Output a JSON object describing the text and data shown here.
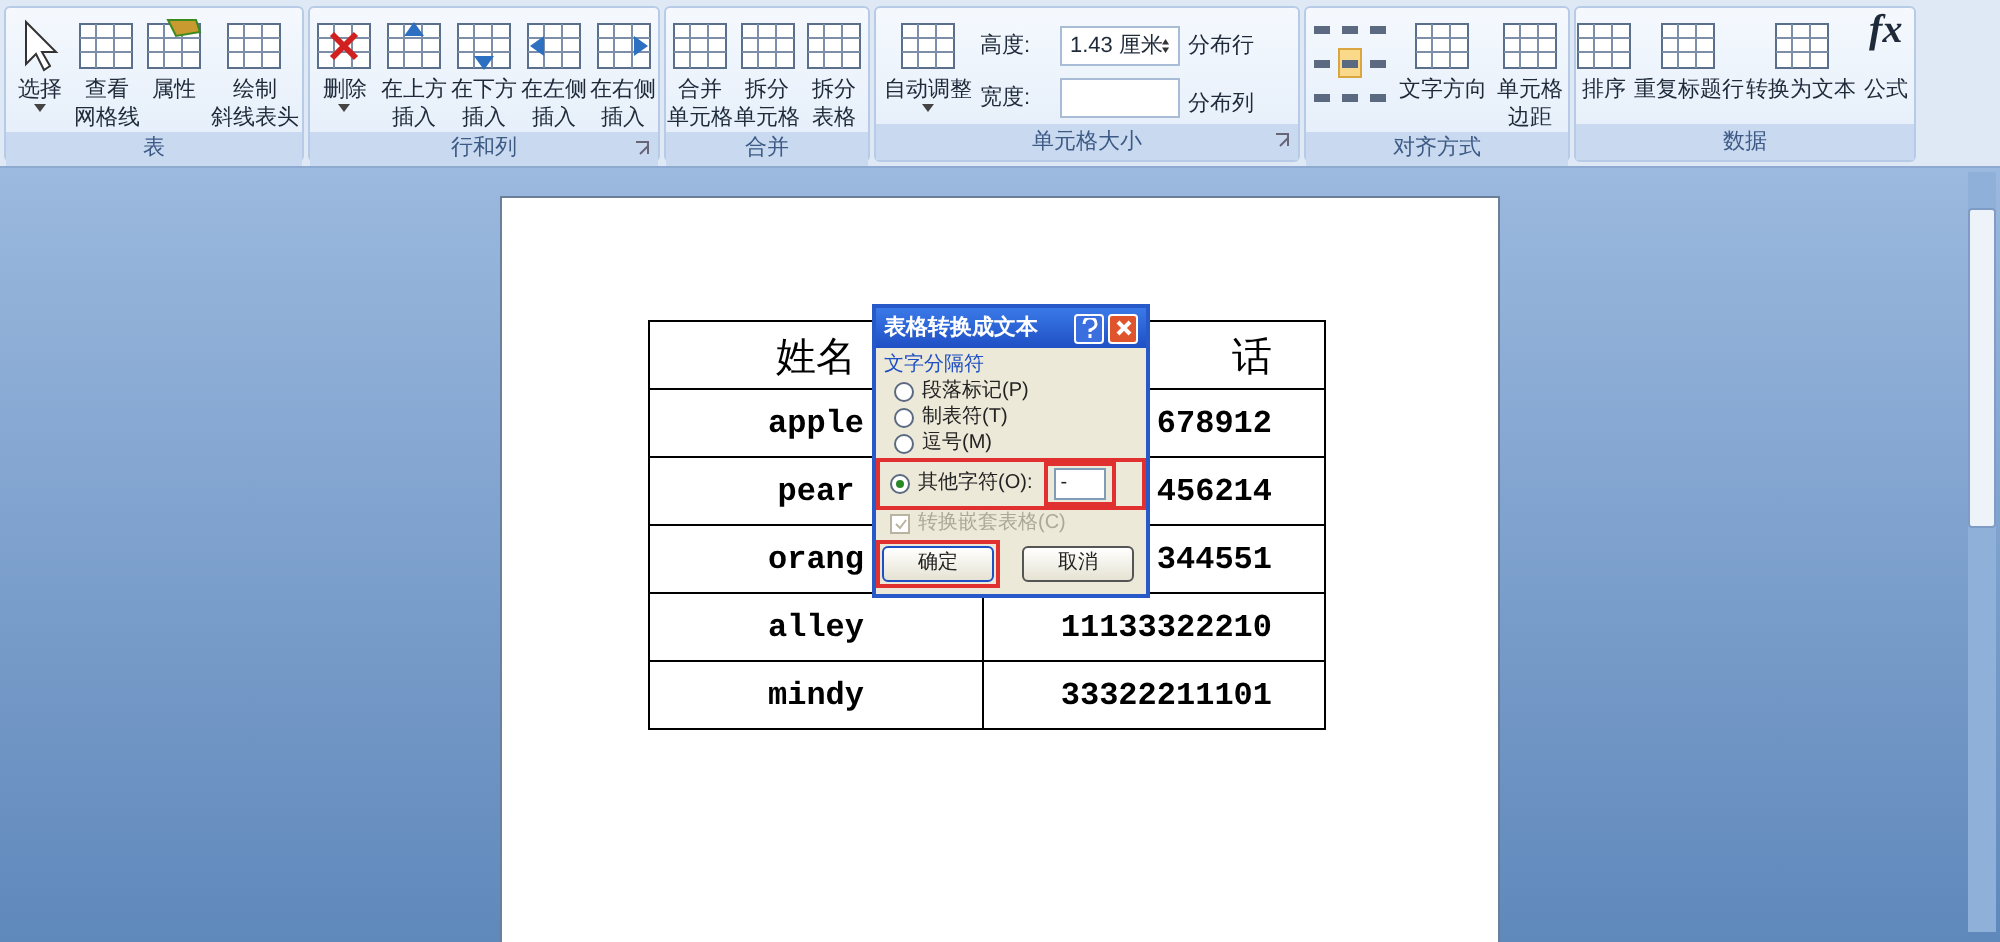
{
  "ribbon": {
    "groups": [
      {
        "label": "表",
        "launcher": false,
        "items": [
          {
            "lines": [
              "选择"
            ],
            "dropdown": true
          },
          {
            "lines": [
              "查看",
              "网格线"
            ],
            "dropdown": false
          },
          {
            "lines": [
              "属性"
            ],
            "dropdown": false
          },
          {
            "lines": [
              "绘制",
              "斜线表头"
            ],
            "dropdown": false
          }
        ]
      },
      {
        "label": "行和列",
        "launcher": true,
        "items": [
          {
            "lines": [
              "删除"
            ],
            "dropdown": true
          },
          {
            "lines": [
              "在上方",
              "插入"
            ],
            "dropdown": false
          },
          {
            "lines": [
              "在下方",
              "插入"
            ],
            "dropdown": false
          },
          {
            "lines": [
              "在左侧",
              "插入"
            ],
            "dropdown": false
          },
          {
            "lines": [
              "在右侧",
              "插入"
            ],
            "dropdown": false
          }
        ]
      },
      {
        "label": "合并",
        "launcher": false,
        "items": [
          {
            "lines": [
              "合并",
              "单元格"
            ],
            "dropdown": false
          },
          {
            "lines": [
              "拆分",
              "单元格"
            ],
            "dropdown": false
          },
          {
            "lines": [
              "拆分",
              "表格"
            ],
            "dropdown": false
          }
        ]
      }
    ],
    "cell_size": {
      "label": "单元格大小",
      "autofit": {
        "lines": [
          "自动调整"
        ],
        "dropdown": true
      },
      "height_label": "高度:",
      "height_value": "1.43 厘米",
      "width_label": "宽度:",
      "distribute_rows": "分布行",
      "distribute_columns": "分布列"
    },
    "alignment": {
      "label": "对齐方式",
      "cells": [
        {
          "selected": false
        },
        {
          "selected": false
        },
        {
          "selected": false
        },
        {
          "selected": false
        },
        {
          "selected": true
        },
        {
          "selected": false
        },
        {
          "selected": false
        },
        {
          "selected": false
        },
        {
          "selected": false
        }
      ],
      "text_direction": "文字方向",
      "margins": [
        "单元格",
        "边距"
      ]
    },
    "data": {
      "label": "数据",
      "formula_glyph": "fx",
      "items": [
        {
          "lines": [
            "排序"
          ]
        },
        {
          "lines": [
            "重复标题行"
          ]
        },
        {
          "lines": [
            "转换为文本"
          ]
        },
        {
          "lines": [
            "公式"
          ]
        }
      ]
    }
  },
  "table": {
    "rows": [
      {
        "name": "姓名",
        "phone": "话",
        "header": true
      },
      {
        "name": "apple",
        "phone": "678912",
        "header": false
      },
      {
        "name": "pear",
        "phone": "456214",
        "header": false
      },
      {
        "name": "orang",
        "phone": "344551",
        "header": false
      },
      {
        "name": "alley",
        "phone": "11133322210",
        "header": false
      },
      {
        "name": "mindy",
        "phone": "33322211101",
        "header": false
      }
    ]
  },
  "dialog": {
    "title": "表格转换成文本",
    "group_label": "文字分隔符",
    "options": [
      {
        "label": "段落标记(P)",
        "selected": false
      },
      {
        "label": "制表符(T)",
        "selected": false
      },
      {
        "label": "逗号(M)",
        "selected": false
      },
      {
        "label": "其他字符(O):",
        "selected": true
      }
    ],
    "other_value": "-",
    "nested": {
      "label": "转换嵌套表格(C)",
      "checked": true,
      "disabled": true
    },
    "buttons": [
      "确定",
      "取消"
    ]
  }
}
